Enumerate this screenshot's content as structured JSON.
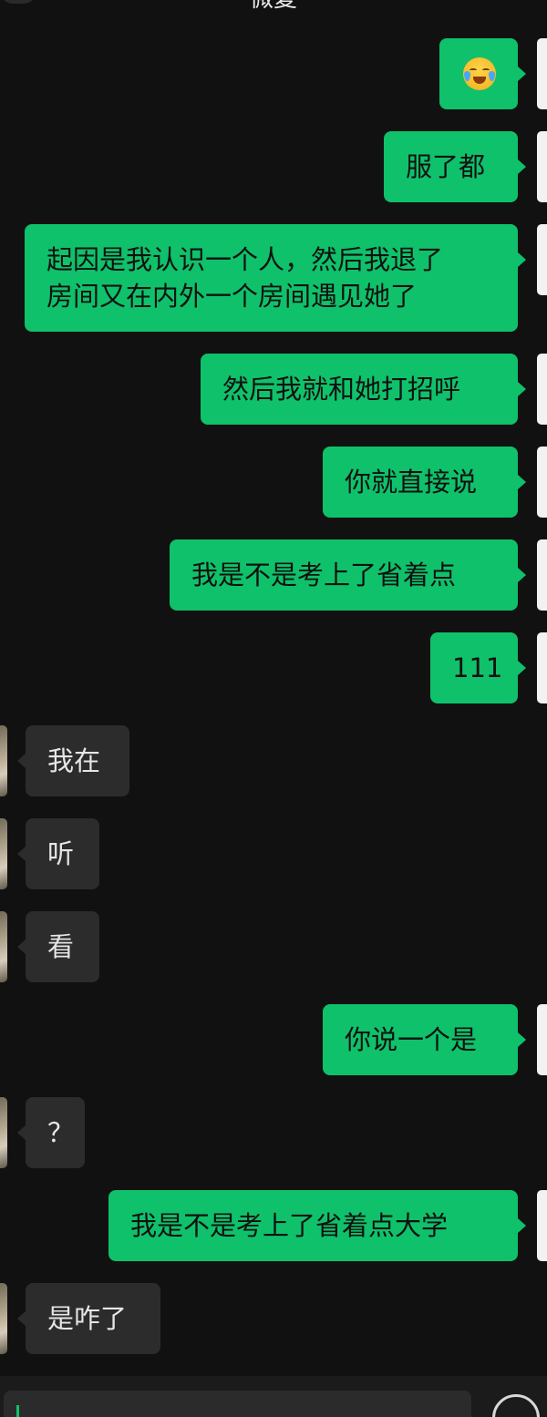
{
  "header": {
    "title": "微复"
  },
  "messages": [
    {
      "side": "sent",
      "type": "emoji",
      "icon": "crying-laughing-emoji"
    },
    {
      "side": "sent",
      "text": "服了都"
    },
    {
      "side": "sent",
      "lines": [
        "起因是我认识一个人，然后我退了",
        "房间又在内外一个房间遇见她了"
      ]
    },
    {
      "side": "sent",
      "text": "然后我就和她打招呼"
    },
    {
      "side": "sent",
      "text": "你就直接说"
    },
    {
      "side": "sent",
      "text": "我是不是考上了省着点"
    },
    {
      "side": "sent",
      "text": "111"
    },
    {
      "side": "recv",
      "text": "我在"
    },
    {
      "side": "recv",
      "text": "听"
    },
    {
      "side": "recv",
      "text": "看"
    },
    {
      "side": "sent",
      "text": "你说一个是"
    },
    {
      "side": "recv",
      "text": "？"
    },
    {
      "side": "sent",
      "text": "我是不是考上了省着点大学"
    },
    {
      "side": "recv",
      "text": "是咋了"
    }
  ],
  "colors": {
    "sent_bubble": "#0fc16a",
    "recv_bubble": "#2c2c2c",
    "background": "#111111"
  }
}
